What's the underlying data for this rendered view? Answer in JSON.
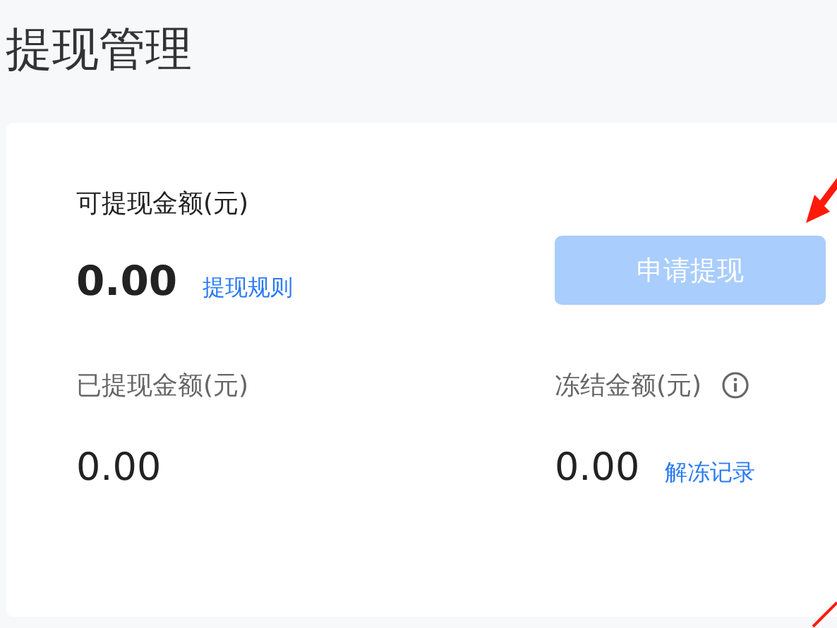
{
  "title": "提现管理",
  "available": {
    "label": "可提现金额(元)",
    "amount": "0.00",
    "link": "提现规则"
  },
  "withdraw_button": {
    "label": "申请提现",
    "disabled": true
  },
  "withdrawn": {
    "label": "已提现金额(元)",
    "amount": "0.00"
  },
  "frozen": {
    "label": "冻结金额(元)",
    "amount": "0.00",
    "link": "解冻记录",
    "info": true
  }
}
